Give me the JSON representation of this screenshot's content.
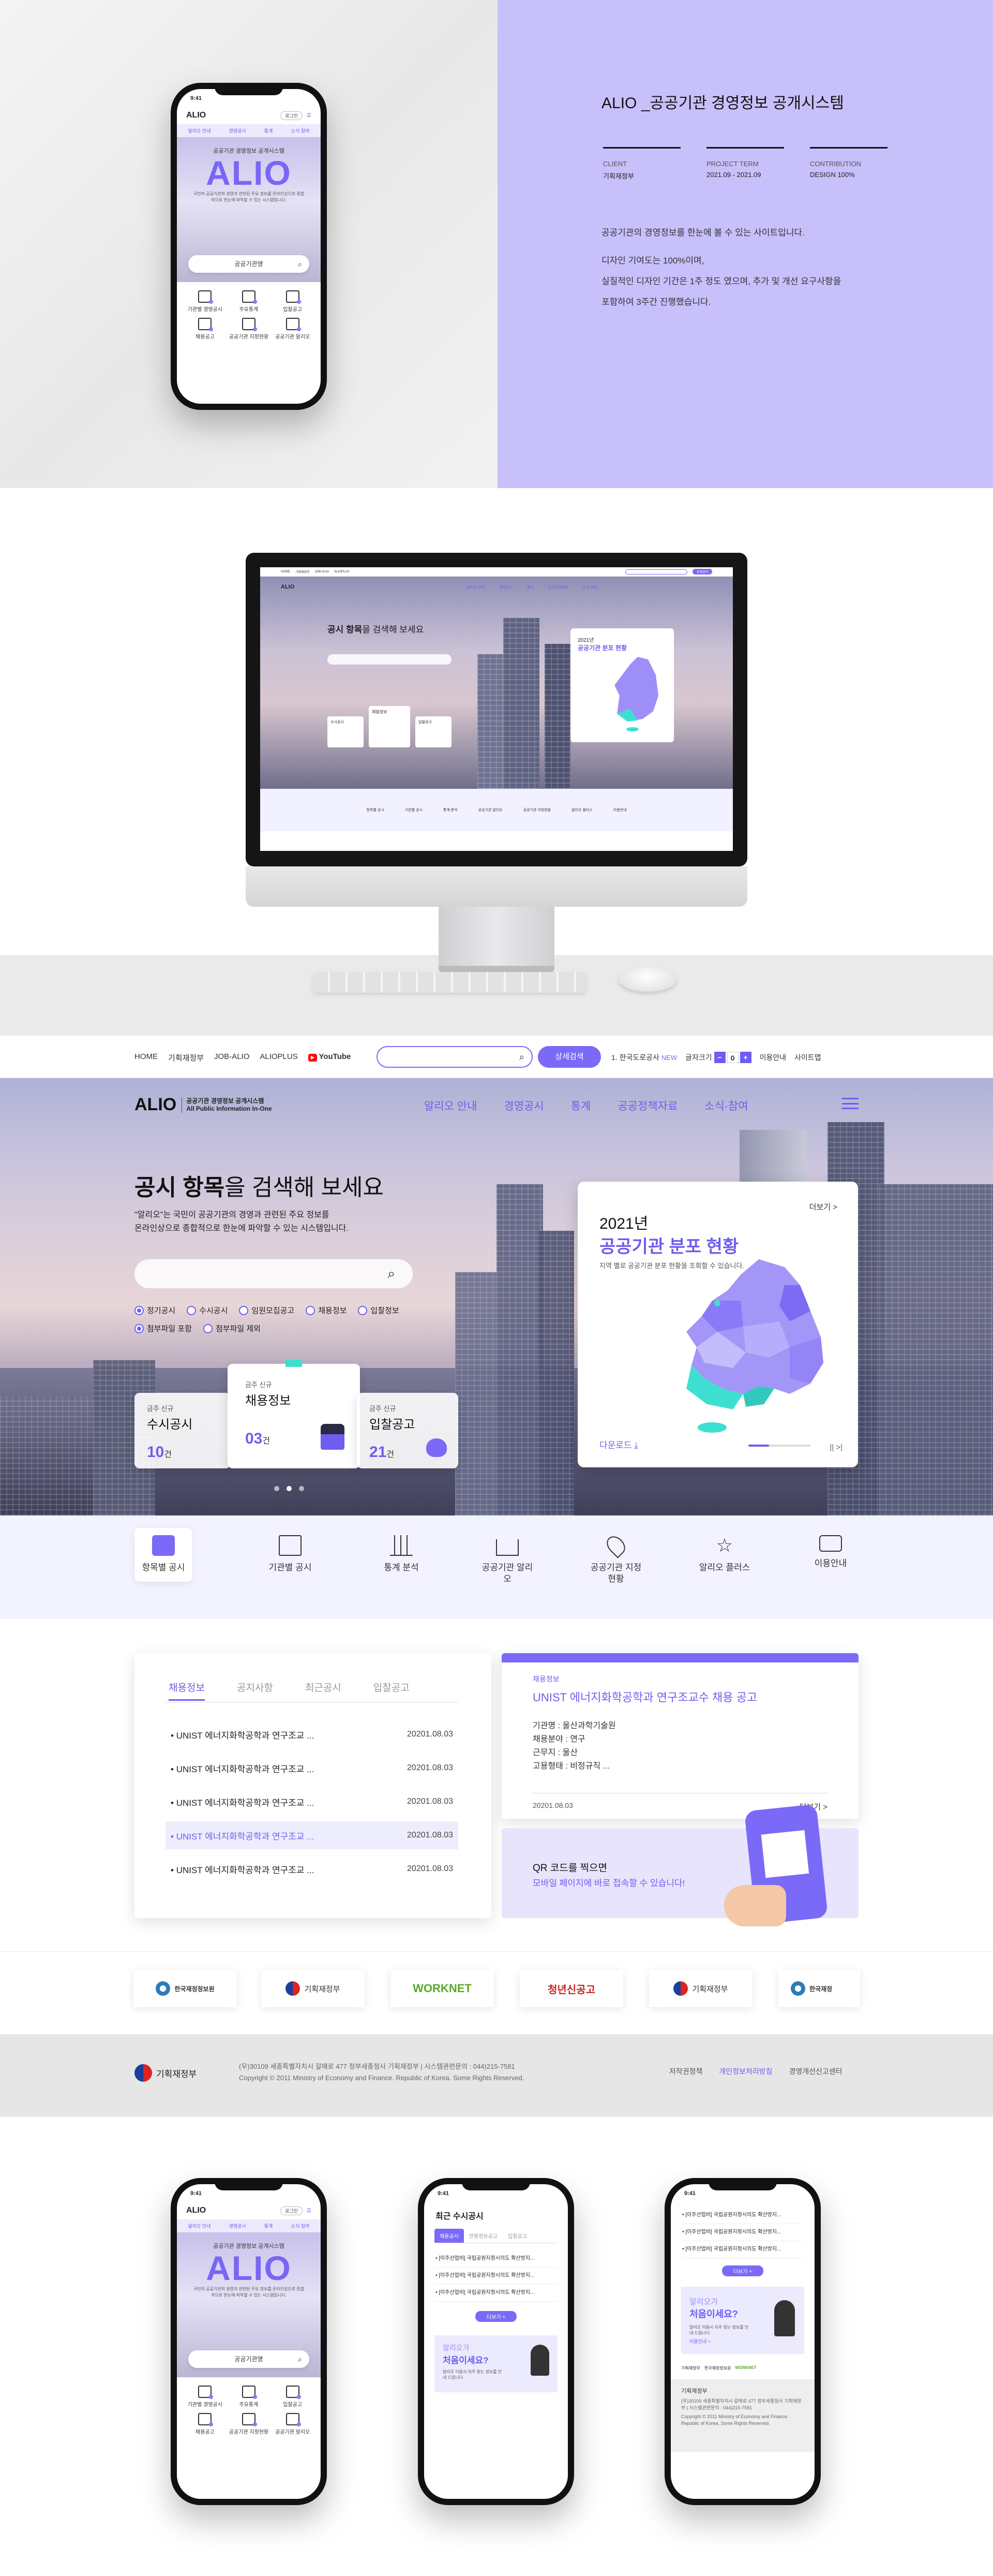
{
  "project": {
    "title": "ALIO _공공기관 경영정보 공개시스템",
    "client_label": "CLIENT",
    "client": "기획재정부",
    "term_label": "PROJECT TERM",
    "term": "2021.09 - 2021.09",
    "contrib_label": "CONTRIBUTION",
    "contrib": "DESIGN 100%",
    "desc": [
      "공공기관의 경영정보를 한눈에 볼 수 있는 사이트입니다.",
      "디자인 기여도는 100%이며,",
      "실질적인 디자인 기간은 1주 정도 였으며, 추가 및 개선 요구사항을",
      "포함하여 3주간 진행했습니다."
    ]
  },
  "mobile": {
    "time": "9:41",
    "logo": "ALIO",
    "login": "로그인",
    "nav": [
      "알리오 안내",
      "경영공시",
      "통계",
      "소식·참여"
    ],
    "hero_sub": "공공기관 경영정보 공개시스템",
    "hero_big": "ALIO",
    "hero_desc": "국민의 공공기관의 경영과 관련된 주요 정보를 온라인상으로 종합적으로 한눈에 파악할 수 있는 시스템입니다.",
    "search": "공공기관명",
    "grid": [
      "기관별 경영공시",
      "주요통계",
      "입찰공고",
      "채용공고",
      "공공기관 지정현황",
      "공공기관 알리오"
    ],
    "list_title": "최근 수시공시",
    "list_tabs": [
      "채용공시",
      "연봉정보공고",
      "입찰공고"
    ],
    "list_item": "[이주산업비] 국립공원지정시의도 확산방지...",
    "list_more": "더보기 +",
    "banner_1": "알리오가",
    "banner_2": "처음이세요?",
    "banner_desc": "알리오 이용시 자주 찾는 정보를 안내 드립니다.",
    "banner_link": "이용안내 >",
    "footer_emblem": "기획재정부"
  },
  "topbar": {
    "links": [
      "HOME",
      "기획재정부",
      "JOB-ALIO",
      "ALIOPLUS"
    ],
    "youtube": "YouTube",
    "search_btn": "상세검색",
    "lang": "한국도로공사",
    "new": "NEW",
    "fontsize": "글자크기",
    "minus": "−",
    "zero": "0",
    "plus": "+",
    "guide": "이용안내",
    "sitemap": "사이트맵"
  },
  "header": {
    "logo": "ALIO",
    "logo_kr": "공공기관 경영정보 공개시스템",
    "logo_en": "All Public Information In-One",
    "gnb": [
      "알리오 안내",
      "경영공시",
      "통계",
      "공공정책자료",
      "소식·참여"
    ]
  },
  "hero": {
    "title_b": "공시 항목",
    "title_r": "을 검색해 보세요",
    "desc1": "\"알리오\"는 국민이 공공기관의 경영과 관련된 주요 정보를",
    "desc2": "온라인상으로 종합적으로 한눈에 파악할 수 있는 시스템입니다.",
    "checks": [
      {
        "label": "정기공시",
        "on": true
      },
      {
        "label": "수시공시",
        "on": false
      },
      {
        "label": "임원모집공고",
        "on": false
      },
      {
        "label": "채용정보",
        "on": false
      },
      {
        "label": "입찰정보",
        "on": false
      },
      {
        "label": "첨부파일 포함",
        "on": true
      },
      {
        "label": "첨부파일 제외",
        "on": false
      }
    ],
    "cards": [
      {
        "sub": "금주 신규",
        "title": "수시공시",
        "num": "10",
        "unit": "건"
      },
      {
        "sub": "금주 신규",
        "title": "채용정보",
        "num": "03",
        "unit": "건"
      },
      {
        "sub": "금주 신규",
        "title": "입찰공고",
        "num": "21",
        "unit": "건"
      }
    ],
    "map": {
      "year": "2021년",
      "title": "공공기관 분포 현황",
      "desc": "지역 별로 공공기관 분포 현황을 조회할 수 있습니다.",
      "more": "더보기 >",
      "download": "다운로드 ⤓",
      "ctrl": "|| >|"
    }
  },
  "quick": [
    "항목별 공시",
    "기관별 공시",
    "통계 분석",
    "공공기관 알리오",
    "공공기관 지정현황",
    "알리오 플러스",
    "이용안내"
  ],
  "board": {
    "tabs": [
      "채용정보",
      "공지사항",
      "최근공시",
      "입찰공고"
    ],
    "rows": [
      {
        "title": "UNIST 에너지화학공학과 연구조교 ...",
        "date": "20201.08.03"
      },
      {
        "title": "UNIST 에너지화학공학과 연구조교 ...",
        "date": "20201.08.03"
      },
      {
        "title": "UNIST 에너지화학공학과 연구조교 ...",
        "date": "20201.08.03"
      },
      {
        "title": "UNIST 에너지화학공학과 연구조교 ...",
        "date": "20201.08.03"
      },
      {
        "title": "UNIST 에너지화학공학과 연구조교 ...",
        "date": "20201.08.03"
      }
    ]
  },
  "job": {
    "tag": "채용정보",
    "title": "UNIST 에너지화학공학과 연구조교수 채용 공고",
    "lines": [
      "기관명 : 울산과학기술원",
      "채용분야 : 연구",
      "근무지 : 울산",
      "고용형태 : 비정규직 ..."
    ],
    "date": "20201.08.03",
    "more": "더보기 >"
  },
  "qr": {
    "line1": "QR 코드를 찍으면",
    "line2": "모바일 페이지에 바로 접속할 수 있습니다!"
  },
  "logos": [
    "한국재정정보원",
    "기획재정부",
    "WORKNET",
    "청년신공고",
    "기획재정부",
    "한국재정"
  ],
  "footer": {
    "emblem": "기획재정부",
    "addr": "(우)30109 세종특별자치시 갈매로 477 정부세종청사 기획재정부 | 시스템관련문의 : 044)215-7581",
    "copy": "Copyright © 2011 Ministry of Economy and Finance. Republic of Korea. Some Rights Reserved.",
    "links": [
      "저작권정책",
      "개인정보처리방침",
      "경영개선신고센터"
    ]
  },
  "colors": {
    "accent": "#7a6af7",
    "lavender": "#c7c0fb",
    "dark": "#6e5df0"
  }
}
